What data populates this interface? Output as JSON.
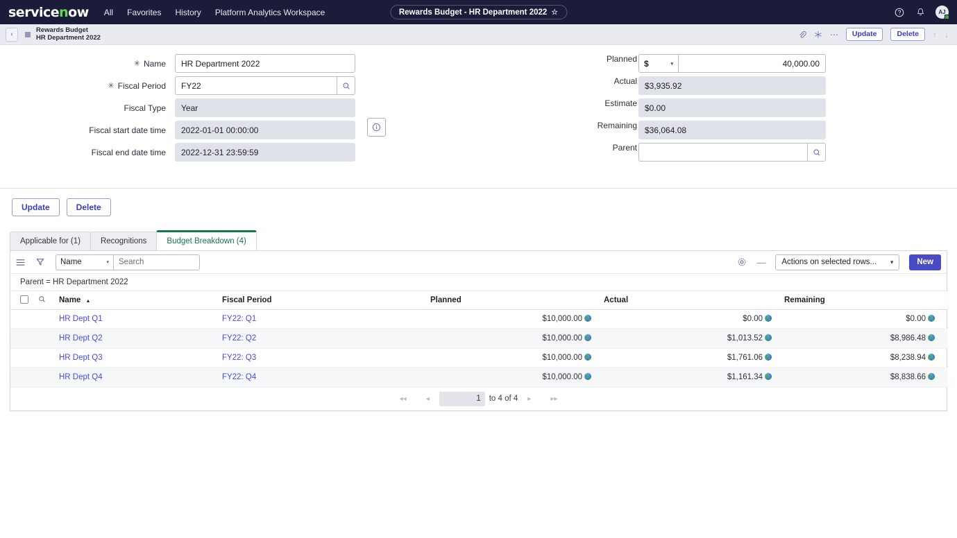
{
  "nav": {
    "logo": "servicenow",
    "links": [
      "All",
      "Favorites",
      "History",
      "Platform Analytics Workspace"
    ],
    "tab_pill": "Rewards Budget - HR Department 2022",
    "star_glyph": "☆",
    "help_icon": "help-icon",
    "bell_icon": "bell-icon",
    "avatar_initials": "AJ"
  },
  "breadcrumb": {
    "back_glyph": "‹",
    "title_line1": "Rewards Budget",
    "title_line2": "HR Department 2022",
    "attachment_glyph": "✐",
    "ai_glyph": "✳",
    "more_glyph": "⋯",
    "update_label": "Update",
    "delete_label": "Delete",
    "up_glyph": "↑",
    "down_glyph": "↓"
  },
  "form": {
    "required_glyph": "✳",
    "search_glyph": "⌕",
    "info_glyph": "ⓘ",
    "left": [
      {
        "label": "Name",
        "value": "HR Department 2022",
        "required": true,
        "type": "input"
      },
      {
        "label": "Fiscal Period",
        "value": "FY22",
        "required": true,
        "type": "reference"
      },
      {
        "label": "Fiscal Type",
        "value": "Year",
        "required": false,
        "type": "static"
      },
      {
        "label": "Fiscal start date time",
        "value": "2022-01-01 00:00:00",
        "required": false,
        "type": "static"
      },
      {
        "label": "Fiscal end date time",
        "value": "2022-12-31 23:59:59",
        "required": false,
        "type": "static"
      }
    ],
    "right": [
      {
        "label": "Planned",
        "currency": "$",
        "value": "40,000.00",
        "type": "currency"
      },
      {
        "label": "Actual",
        "value": "$3,935.92",
        "type": "static"
      },
      {
        "label": "Estimate",
        "value": "$0.00",
        "type": "static"
      },
      {
        "label": "Remaining",
        "value": "$36,064.08",
        "type": "static"
      },
      {
        "label": "Parent",
        "value": "",
        "type": "reference"
      }
    ]
  },
  "actions": {
    "update_label": "Update",
    "delete_label": "Delete"
  },
  "tabs": [
    {
      "label": "Applicable for (1)",
      "active": false
    },
    {
      "label": "Recognitions",
      "active": false
    },
    {
      "label": "Budget Breakdown (4)",
      "active": true
    }
  ],
  "list": {
    "menu_glyph": "☰",
    "filter_glyph": "∇",
    "sort_field": "Name",
    "caret_glyph": "▾",
    "search_placeholder": "Search",
    "settings_glyph": "⚙",
    "minus_glyph": "—",
    "actions_label": "Actions on selected rows...",
    "new_label": "New",
    "breadcrumb_condition": "Parent = HR Department 2022",
    "search_col_glyph": "⌕",
    "sort_asc_glyph": "▲",
    "columns": [
      "Name",
      "Fiscal Period",
      "Planned",
      "Actual",
      "Remaining"
    ],
    "rows": [
      {
        "name": "HR Dept Q1",
        "fiscal_period": "FY22: Q1",
        "planned": "$10,000.00",
        "actual": "$0.00",
        "remaining": "$0.00"
      },
      {
        "name": "HR Dept Q2",
        "fiscal_period": "FY22: Q2",
        "planned": "$10,000.00",
        "actual": "$1,013.52",
        "remaining": "$8,986.48"
      },
      {
        "name": "HR Dept Q3",
        "fiscal_period": "FY22: Q3",
        "planned": "$10,000.00",
        "actual": "$1,761.06",
        "remaining": "$8,238.94"
      },
      {
        "name": "HR Dept Q4",
        "fiscal_period": "FY22: Q4",
        "planned": "$10,000.00",
        "actual": "$1,161.34",
        "remaining": "$8,838.66"
      }
    ],
    "pager": {
      "first_glyph": "◂◂",
      "prev_glyph": "◂",
      "page": "1",
      "range_text": "to 4 of 4",
      "next_glyph": "▸",
      "last_glyph": "▸▸"
    }
  },
  "colors": {
    "nav_bg": "#1b1b3a",
    "accent": "#4a4ac4",
    "active_tab": "#0f7b46",
    "link": "#4a4ae0"
  }
}
